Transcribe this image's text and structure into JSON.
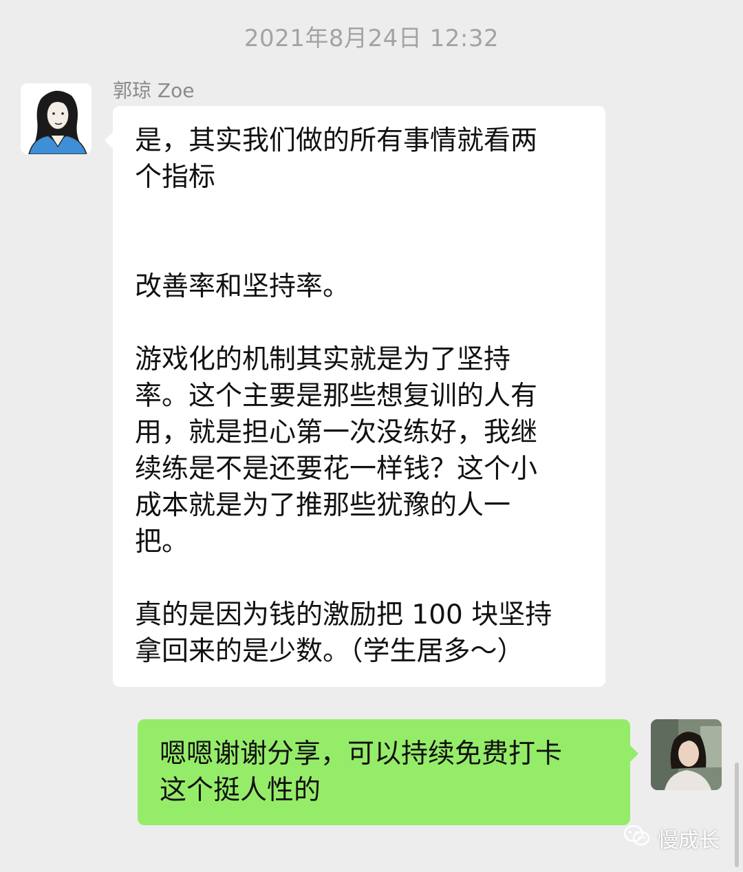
{
  "timestamp": "2021年8月24日 12:32",
  "incoming": {
    "sender_name": "郭琼 Zoe",
    "avatar_icon": "illustrated-woman-avatar-icon",
    "paragraphs": [
      "是，其实我们做的所有事情就看两\n个指标",
      "改善率和坚持率。",
      "游戏化的机制其实就是为了坚持\n率。这个主要是那些想复训的人有\n用，就是担心第一次没练好，我继\n续练是不是还要花一样钱？这个小\n成本就是为了推那些犹豫的人一\n把。",
      "真的是因为钱的激励把 100 块坚持\n拿回来的是少数。（学生居多～）"
    ]
  },
  "outgoing": {
    "avatar_icon": "photo-woman-avatar-icon",
    "text": "嗯嗯谢谢分享，可以持续免费打卡\n这个挺人性的"
  },
  "watermark": {
    "icon": "wechat-official-account-icon",
    "label": "慢成长"
  },
  "colors": {
    "background": "#ededed",
    "incoming_bubble": "#ffffff",
    "outgoing_bubble": "#95ec69",
    "timestamp_text": "#a3a3a3"
  }
}
